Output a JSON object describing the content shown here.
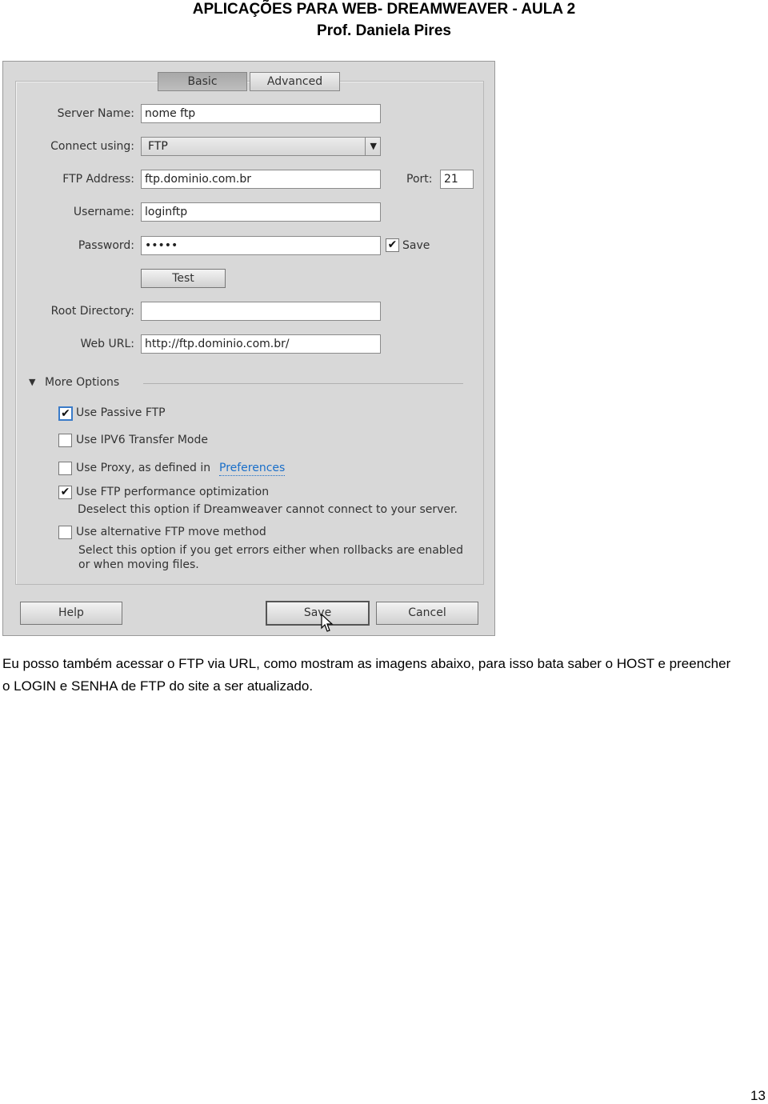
{
  "header": {
    "line1": "APLICAÇÕES PARA WEB- DREAMWEAVER  - AULA 2",
    "line2": "Prof. Daniela Pires"
  },
  "dialog": {
    "tabs": [
      {
        "label": "Basic",
        "selected": true
      },
      {
        "label": "Advanced",
        "selected": false
      }
    ],
    "fields": {
      "server_name": {
        "label": "Server Name:",
        "value": "nome ftp"
      },
      "connect_using": {
        "label": "Connect using:",
        "value": "FTP"
      },
      "ftp_address": {
        "label": "FTP Address:",
        "value": "ftp.dominio.com.br"
      },
      "port": {
        "label": "Port:",
        "value": "21"
      },
      "username": {
        "label": "Username:",
        "value": "loginftp"
      },
      "password": {
        "label": "Password:",
        "value": "•••••"
      },
      "save_password": {
        "label": "Save",
        "checked": true
      },
      "root_directory": {
        "label": "Root Directory:",
        "value": ""
      },
      "web_url": {
        "label": "Web URL:",
        "value": "http://ftp.dominio.com.br/"
      }
    },
    "test_label": "Test",
    "more_options": "More Options",
    "options": [
      {
        "label": "Use Passive FTP",
        "checked": true
      },
      {
        "label": "Use IPV6 Transfer Mode",
        "checked": false
      },
      {
        "label": "Use Proxy, as defined in",
        "link": "Preferences",
        "checked": false
      },
      {
        "label": "Use FTP performance optimization",
        "checked": true,
        "desc": "Deselect this option if Dreamweaver cannot connect to your server."
      },
      {
        "label": "Use alternative FTP move method",
        "checked": false,
        "desc": "Select this option if you get errors either when rollbacks are enabled",
        "desc2": "or when moving files."
      }
    ],
    "buttons": {
      "help": "Help",
      "save": "Save",
      "cancel": "Cancel"
    },
    "link_color": "#1a6fc9"
  },
  "body": {
    "line1": "Eu posso também acessar o FTP via URL, como mostram as imagens abaixo, para isso bata saber o HOST e preencher",
    "line2": "o LOGIN e SENHA de FTP do site a ser atualizado."
  },
  "page_number": "13"
}
